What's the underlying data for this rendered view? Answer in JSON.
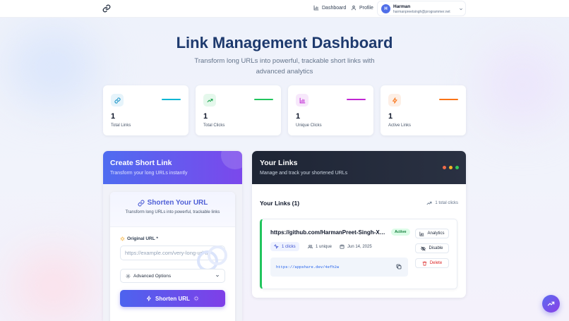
{
  "header": {
    "nav": {
      "dashboard": "Dashboard",
      "profile": "Profile"
    },
    "user": {
      "initial": "H",
      "name": "Harman",
      "email": "harmanpreetsingh@programmer.net"
    }
  },
  "hero": {
    "title": "Link Management Dashboard",
    "subtitle": "Transform long URLs into powerful, trackable short links with advanced analytics"
  },
  "stats": [
    {
      "value": "1",
      "label": "Total Links",
      "icon": "link-icon",
      "accent": "#06b6d4"
    },
    {
      "value": "1",
      "label": "Total Clicks",
      "icon": "trending-up-icon",
      "accent": "#22c55e"
    },
    {
      "value": "1",
      "label": "Unique Clicks",
      "icon": "bar-chart-icon",
      "accent": "#c026d3"
    },
    {
      "value": "1",
      "label": "Active Links",
      "icon": "zap-icon",
      "accent": "#f97316"
    }
  ],
  "create": {
    "title": "Create Short Link",
    "subtitle": "Transform your long URLs instantly",
    "card_title": "Shorten Your URL",
    "card_subtitle": "Transform long URLs into powerful, trackable links",
    "url_label": "Original URL *",
    "url_placeholder": "https://example.com/very-long-url-th",
    "advanced_label": "Advanced Options",
    "submit_label": "Shorten URL"
  },
  "links": {
    "title": "Your Links",
    "subtitle": "Manage and track your shortened URLs",
    "list_title": "Your Links (1)",
    "total_clicks": "1 total clicks",
    "items": [
      {
        "url": "https://github.com/HarmanPreet-Singh-XYT/AppShare",
        "status": "Active",
        "clicks": "1 clicks",
        "unique": "1 unique",
        "date": "Jun 14, 2025",
        "short_url": "https://appshare.dev/4efh2w",
        "actions": {
          "analytics": "Analytics",
          "disable": "Disable",
          "delete": "Delete"
        }
      }
    ]
  },
  "colors": {
    "brand_blue": "#4f6cf0",
    "brand_purple": "#7b48ec",
    "dark_header": "#1e2535",
    "active_green": "#22c55e",
    "danger": "#dc2626",
    "window_dots": [
      "#ef6b4a",
      "#f5b324",
      "#34c759"
    ]
  }
}
